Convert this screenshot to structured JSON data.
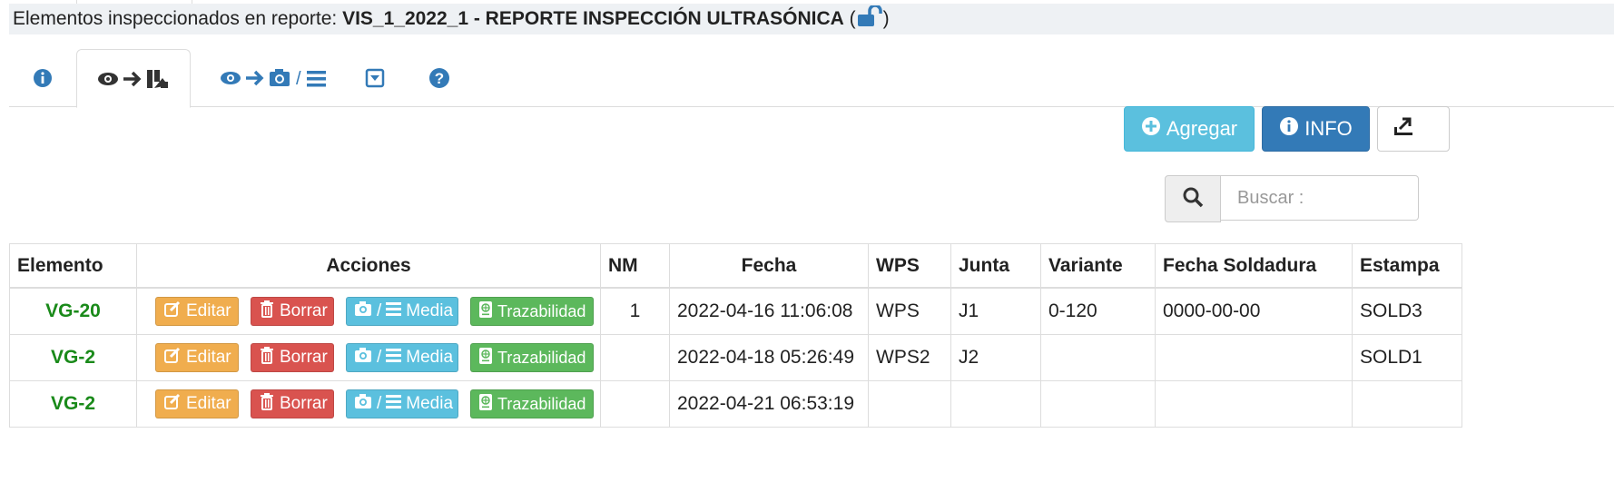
{
  "header": {
    "prefix": "Elementos inspeccionados en reporte: ",
    "report_name": "VIS_1_2022_1 - REPORTE INSPECCIÓN ULTRASÓNICA",
    "open_paren": "(",
    "close_paren": ")"
  },
  "tabs": [
    {
      "name": "info",
      "icon": "info-circle-icon"
    },
    {
      "name": "view-to-elements",
      "icon": "eye-arrow-elements-icon",
      "active": true
    },
    {
      "name": "view-to-media",
      "icon": "eye-arrow-camera-list-icon",
      "sep": "/"
    },
    {
      "name": "dropdown",
      "icon": "caret-square-down-icon"
    },
    {
      "name": "help",
      "icon": "question-circle-icon"
    }
  ],
  "toolbar": {
    "add_label": "Agregar",
    "info_label": "INFO"
  },
  "search": {
    "placeholder": "Buscar :"
  },
  "table": {
    "columns": [
      "Elemento",
      "Acciones",
      "NM",
      "Fecha",
      "WPS",
      "Junta",
      "Variante",
      "Fecha Soldadura",
      "Estampa"
    ],
    "actions": {
      "edit": "Editar",
      "delete": "Borrar",
      "media_sep": "/",
      "media": "Media",
      "trace": "Trazabilidad"
    },
    "rows": [
      {
        "elemento": "VG-20",
        "nm": "1",
        "fecha": "2022-04-16 11:06:08",
        "wps": "WPS",
        "junta": "J1",
        "variante": "0-120",
        "fecha_soldadura": "0000-00-00",
        "estampa": "SOLD3"
      },
      {
        "elemento": "VG-2",
        "nm": "",
        "fecha": "2022-04-18 05:26:49",
        "wps": "WPS2",
        "junta": "J2",
        "variante": "",
        "fecha_soldadura": "",
        "estampa": "SOLD1"
      },
      {
        "elemento": "VG-2",
        "nm": "",
        "fecha": "2022-04-21 06:53:19",
        "wps": "",
        "junta": "",
        "variante": "",
        "fecha_soldadura": "",
        "estampa": ""
      }
    ]
  },
  "colors": {
    "primary": "#337ab7",
    "info": "#5bc0de",
    "warning": "#f0ad4e",
    "danger": "#d9534f",
    "success": "#5cb85c",
    "element_green": "#1a8a1a"
  }
}
